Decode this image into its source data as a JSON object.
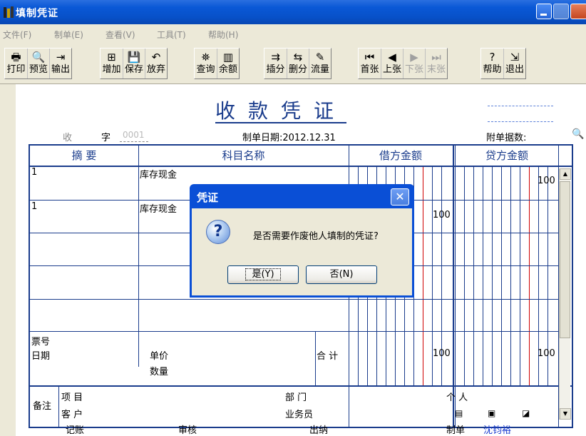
{
  "window": {
    "title": "填制凭证"
  },
  "menu": [
    "文件(F)",
    "制单(E)",
    "查看(V)",
    "工具(T)",
    "帮助(H)"
  ],
  "toolbar": {
    "groups": [
      [
        {
          "icon": "printer-icon",
          "glyph": "🖶",
          "label": "打印"
        },
        {
          "icon": "preview-icon",
          "glyph": "🔍",
          "label": "预览"
        },
        {
          "icon": "export-icon",
          "glyph": "⇥",
          "label": "输出"
        }
      ],
      [
        {
          "icon": "add-icon",
          "glyph": "⊞",
          "label": "增加"
        },
        {
          "icon": "save-icon",
          "glyph": "💾",
          "label": "保存"
        },
        {
          "icon": "undo-icon",
          "glyph": "↶",
          "label": "放弃"
        }
      ],
      [
        {
          "icon": "binoculars-icon",
          "glyph": "⛯",
          "label": "查询"
        },
        {
          "icon": "chart-icon",
          "glyph": "▥",
          "label": "余额"
        }
      ],
      [
        {
          "icon": "insert-row-icon",
          "glyph": "⇉",
          "label": "插分"
        },
        {
          "icon": "delete-row-icon",
          "glyph": "⇆",
          "label": "删分"
        },
        {
          "icon": "flow-icon",
          "glyph": "✎",
          "label": "流量"
        }
      ],
      [
        {
          "icon": "first-icon",
          "glyph": "⏮",
          "label": "首张"
        },
        {
          "icon": "prev-icon",
          "glyph": "◀",
          "label": "上张"
        },
        {
          "icon": "next-icon",
          "glyph": "▶",
          "label": "下张",
          "disabled": true
        },
        {
          "icon": "last-icon",
          "glyph": "⏭",
          "label": "末张",
          "disabled": true
        }
      ],
      [
        {
          "icon": "help-icon",
          "glyph": "?",
          "label": "帮助"
        },
        {
          "icon": "exit-icon",
          "glyph": "⇲",
          "label": "退出"
        }
      ]
    ]
  },
  "voucher": {
    "title": "收款凭证",
    "type_prefix": "收",
    "zi": "字",
    "number": "0001",
    "date_label": "制单日期:2012.12.31",
    "attachments_label": "附单据数:",
    "headers": {
      "summary": "摘 要",
      "account": "科目名称",
      "debit": "借方金额",
      "credit": "贷方金额"
    },
    "rows": [
      {
        "summary": "1",
        "account": "库存现金",
        "debit": "",
        "credit": "100"
      },
      {
        "summary": "1",
        "account": "库存现金",
        "debit": "100",
        "credit": ""
      },
      {
        "summary": "",
        "account": "",
        "debit": "",
        "credit": ""
      },
      {
        "summary": "",
        "account": "",
        "debit": "",
        "credit": ""
      },
      {
        "summary": "",
        "account": "",
        "debit": "",
        "credit": ""
      }
    ],
    "ticket_no_label": "票号",
    "date_field_label": "日期",
    "unit_price_label": "单价",
    "quantity_label": "数量",
    "total_label": "合 计",
    "total_debit": "100",
    "total_credit": "100",
    "notes_label": "备注",
    "project_label": "项 目",
    "department_label": "部 门",
    "person_label": "个 人",
    "customer_label": "客 户",
    "salesperson_label": "业务员",
    "bookkeeping_label": "记账",
    "review_label": "审核",
    "cashier_label": "出纳",
    "preparer_label": "制单",
    "preparer_name": "沈钧裕"
  },
  "dialog": {
    "title": "凭证",
    "message": "是否需要作废他人填制的凭证?",
    "yes_label": "是(Y)",
    "no_label": "否(N)"
  },
  "colors": {
    "title_blue": "#0a58d6",
    "grid_blue": "#1a3c8c",
    "red_line": "#d00000"
  }
}
